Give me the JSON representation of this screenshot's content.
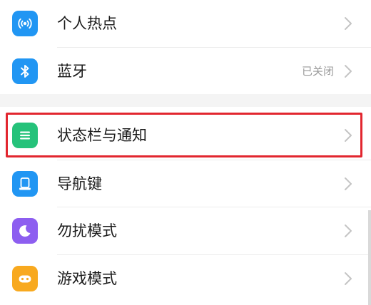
{
  "settings": {
    "group1": [
      {
        "label": "个人热点",
        "icon": "hotspot-icon",
        "color": "#2196f3"
      },
      {
        "label": "蓝牙",
        "value": "已关闭",
        "icon": "bluetooth-icon",
        "color": "#2196f3"
      }
    ],
    "group2": [
      {
        "label": "状态栏与通知",
        "icon": "status-bar-icon",
        "color": "#25c27a",
        "highlighted": true
      },
      {
        "label": "导航键",
        "icon": "navigation-key-icon",
        "color": "#2196f3"
      },
      {
        "label": "勿扰模式",
        "icon": "do-not-disturb-icon",
        "color": "#8d5ef0"
      },
      {
        "label": "游戏模式",
        "icon": "game-mode-icon",
        "color": "#f8a91f"
      }
    ]
  },
  "colors": {
    "highlight_border": "#e2262f",
    "chevron": "#c4c4c4",
    "secondary_text": "#9a9a9a"
  }
}
